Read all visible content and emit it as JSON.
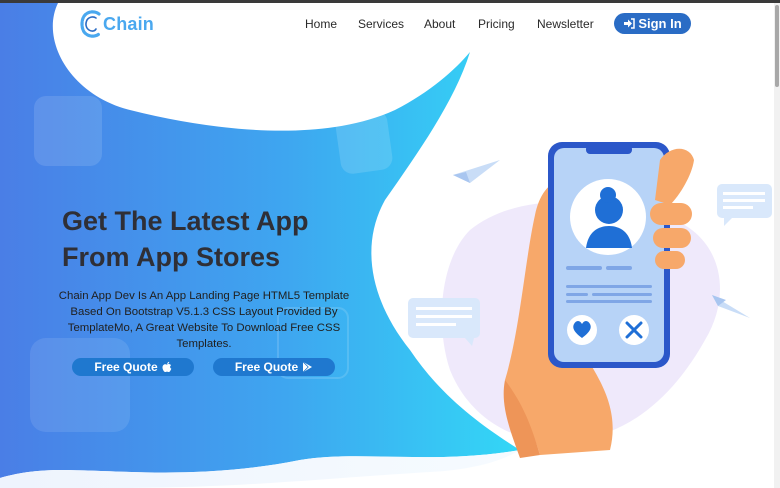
{
  "brand": {
    "name": "Chain",
    "accent": "#4aa8ef"
  },
  "nav": {
    "items": [
      "Home",
      "Services",
      "About",
      "Pricing",
      "Newsletter"
    ],
    "signin_label": "Sign In"
  },
  "hero": {
    "headline_line1": "Get The Latest App",
    "headline_line2": "From App Stores",
    "description": "Chain App Dev Is An App Landing Page HTML5 Template Based On Bootstrap V5.1.3 CSS Layout Provided By TemplateMo, A Great Website To Download Free CSS Templates.",
    "button1_label": "Free Quote",
    "button1_icon": "apple-icon",
    "button2_label": "Free Quote",
    "button2_icon": "play-store-icon"
  },
  "colors": {
    "gradient_start": "#4a7fe8",
    "gradient_end": "#35d6f5",
    "button": "#1f78cf",
    "signin": "#2a6cc5"
  }
}
